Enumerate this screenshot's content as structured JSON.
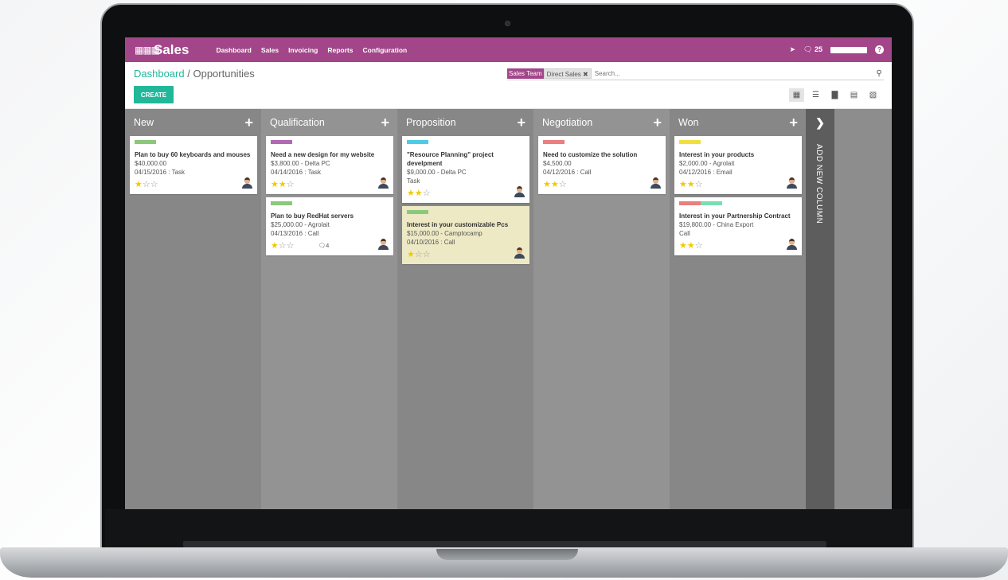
{
  "topbar": {
    "app_name": "Sales",
    "menu": [
      "Dashboard",
      "Sales",
      "Invoicing",
      "Reports",
      "Configuration"
    ],
    "message_count": "25",
    "brand_color": "#a24689"
  },
  "breadcrumb": {
    "parent": "Dashboard",
    "separator": "/",
    "current": "Opportunities"
  },
  "search": {
    "facet_label": "Sales Team",
    "facet_value": "Direct Sales",
    "placeholder": "Search..."
  },
  "create_button": "CREATE",
  "views": [
    "kanban-icon",
    "list-icon",
    "graph-icon",
    "calendar-icon",
    "pivot-icon"
  ],
  "colors": {
    "accent": "#21b799",
    "green": "#8bc87a",
    "purple": "#b06ab3",
    "cyan": "#4fcbe8",
    "red": "#eb7e7f",
    "yellow": "#f2de42",
    "teal": "#79deb0"
  },
  "columns": [
    {
      "name": "New",
      "cards": [
        {
          "tags": [
            "#8bc87a"
          ],
          "title": "Plan to buy 60 keyboards and mouses",
          "amount": "$40,000.00",
          "activity": "04/15/2016 : Task",
          "stars": 1
        }
      ]
    },
    {
      "name": "Qualification",
      "cards": [
        {
          "tags": [
            "#b06ab3"
          ],
          "title": "Need a new design for my website",
          "amount": "$3,800.00 - Delta PC",
          "activity": "04/14/2016 : Task",
          "stars": 2
        },
        {
          "tags": [
            "#8bc87a"
          ],
          "title": "Plan to buy RedHat servers",
          "amount": "$25,000.00 - Agrolait",
          "activity": "04/13/2016 : Call",
          "stars": 1,
          "messages": "4"
        }
      ]
    },
    {
      "name": "Proposition",
      "cards": [
        {
          "tags": [
            "#4fcbe8"
          ],
          "title": "\"Resource Planning\" project develpment",
          "amount": "$9,000.00 - Delta PC",
          "activity": "Task",
          "stars": 2
        },
        {
          "tags": [
            "#8bc87a"
          ],
          "title": "Interest in your customizable Pcs",
          "amount": "$15,000.00 - Camptocamp",
          "activity": "04/10/2016 : Call",
          "stars": 1,
          "highlight": true
        }
      ]
    },
    {
      "name": "Negotiation",
      "cards": [
        {
          "tags": [
            "#eb7e7f"
          ],
          "title": "Need to customize the solution",
          "amount": "$4,500.00",
          "activity": "04/12/2016 : Call",
          "stars": 2
        }
      ]
    },
    {
      "name": "Won",
      "cards": [
        {
          "tags": [
            "#f2de42"
          ],
          "title": "Interest in your products",
          "amount": "$2,000.00 - Agrolait",
          "activity": "04/12/2016 : Email",
          "stars": 2
        },
        {
          "tags": [
            "#eb7e7f",
            "#79deb0"
          ],
          "title": "Interest in your Partnership Contract",
          "amount": "$19,800.00 - China Export",
          "activity": "Call",
          "stars": 2
        }
      ]
    }
  ],
  "add_column_label": "ADD NEW COLUMN"
}
